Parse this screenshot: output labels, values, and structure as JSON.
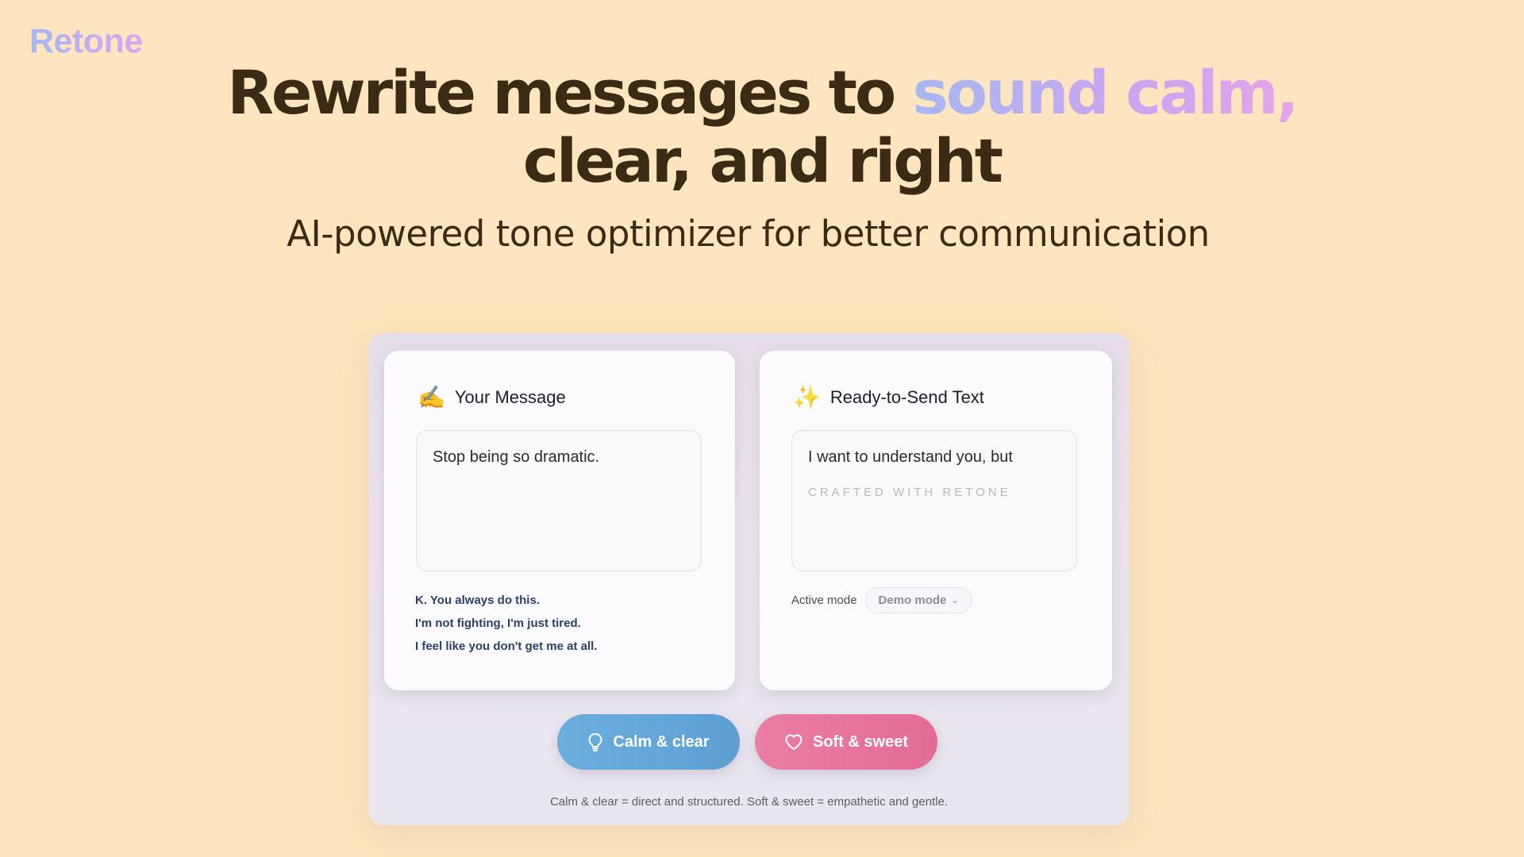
{
  "brand": {
    "logo": "Retone"
  },
  "hero": {
    "headline_start": "Rewrite messages to ",
    "headline_highlight": "sound calm,",
    "headline_end": "clear, and right",
    "subheadline": "AI-powered tone optimizer for better communication"
  },
  "input_card": {
    "emoji": "✍️",
    "title": "Your Message",
    "text": "Stop being so dramatic.",
    "samples": [
      "K.  You always do this.",
      "I'm not fighting, I'm just tired.",
      "I feel like you don't get me at all."
    ]
  },
  "output_card": {
    "emoji": "✨",
    "title": "Ready-to-Send Text",
    "text": "I want to understand you, but",
    "watermark": "CRAFTED WITH RETONE",
    "mode_label": "Active mode",
    "mode_value": "Demo mode"
  },
  "actions": {
    "calm_label": "Calm & clear",
    "soft_label": "Soft & sweet",
    "calm_icon": "lightbulb-icon",
    "soft_icon": "heart-icon"
  },
  "footnote": "Calm & clear = direct and structured. Soft & sweet = empathetic and gentle.",
  "colors": {
    "background": "#fde6bf",
    "heading": "#3b2a14",
    "calm_button": "#64a7da",
    "soft_button": "#e6759e",
    "sample_text": "#2c3f66"
  }
}
